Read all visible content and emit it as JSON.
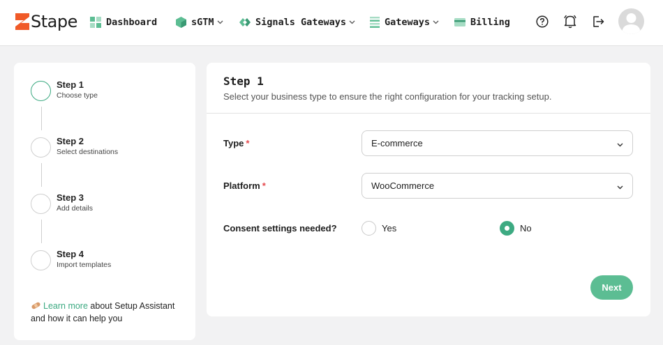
{
  "brand": {
    "logo_text": "Stape",
    "accent": "#3daa82"
  },
  "nav": {
    "dashboard": "Dashboard",
    "sgtm": "sGTM",
    "signals": "Signals Gateways",
    "gateways": "Gateways",
    "billing": "Billing"
  },
  "header_icons": [
    "help-icon",
    "bell-icon",
    "logout-icon",
    "avatar"
  ],
  "steps": [
    {
      "title": "Step 1",
      "subtitle": "Choose type",
      "active": true
    },
    {
      "title": "Step 2",
      "subtitle": "Select destinations",
      "active": false
    },
    {
      "title": "Step 3",
      "subtitle": "Add details",
      "active": false
    },
    {
      "title": "Step 4",
      "subtitle": "Import templates",
      "active": false
    }
  ],
  "learn": {
    "link": "Learn more",
    "rest": " about Setup Assistant and how it can help you"
  },
  "main": {
    "title": "Step 1",
    "subtitle": "Select your business type to ensure the right configuration for your tracking setup.",
    "type_label": "Type",
    "type_value": "E-commerce",
    "platform_label": "Platform",
    "platform_value": "WooCommerce",
    "required_mark": "*",
    "consent_label": "Consent settings needed?",
    "consent_options": [
      "Yes",
      "No"
    ],
    "consent_selected": "No",
    "next_label": "Next"
  }
}
